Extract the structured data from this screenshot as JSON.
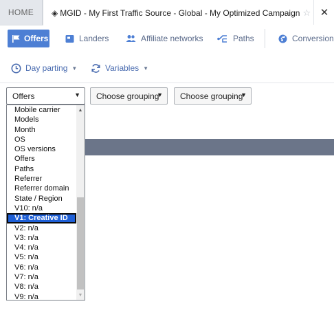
{
  "tabs": {
    "home_label": "HOME",
    "active_label": "MGID - My First Traffic Source - Global - My Optimized Campaign",
    "active_prefix_icon": "diamond-icon",
    "star_icon": "star-icon",
    "close_icon": "close-icon"
  },
  "nav": {
    "items": [
      {
        "label": "Offers",
        "icon": "flag-icon",
        "active": true
      },
      {
        "label": "Landers",
        "icon": "lander-icon"
      },
      {
        "label": "Affiliate networks",
        "icon": "people-icon"
      },
      {
        "label": "Paths",
        "icon": "paths-icon"
      },
      {
        "label": "Conversions",
        "icon": "conversions-icon"
      }
    ],
    "accent_color": "#4d7fd4"
  },
  "filters": {
    "day_parting": "Day parting",
    "variables": "Variables"
  },
  "grouping": {
    "first": "Offers",
    "second": "Choose grouping",
    "third": "Choose grouping"
  },
  "dropdown": {
    "items": [
      "Mobile carrier",
      "Models",
      "Month",
      "OS",
      "OS versions",
      "Offers",
      "Paths",
      "Referrer",
      "Referrer domain",
      "State / Region",
      "V10: n/a",
      "V1: Creative ID",
      "V2: n/a",
      "V3: n/a",
      "V4: n/a",
      "V5: n/a",
      "V6: n/a",
      "V7: n/a",
      "V8: n/a",
      "V9: n/a"
    ],
    "selected": "V1: Creative ID",
    "selected_color": "#1e5fd6"
  },
  "header_band_color": "#6b7589"
}
